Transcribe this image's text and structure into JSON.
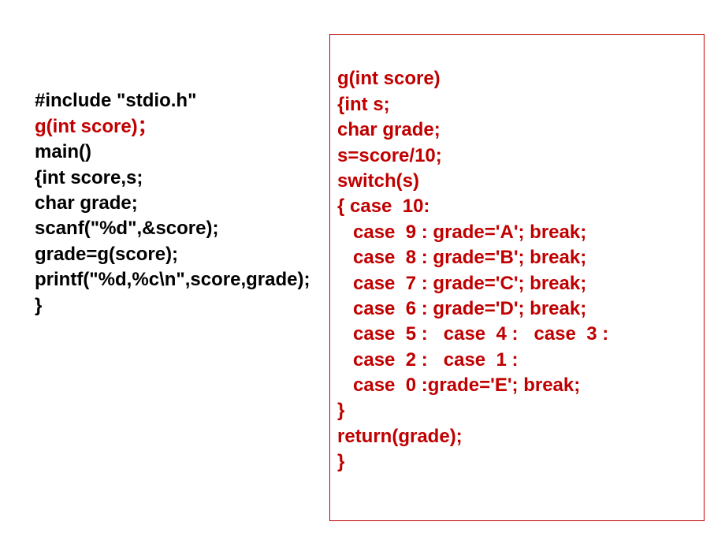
{
  "left": {
    "l1": "#include \"stdio.h\"",
    "l2": "g(int score)；",
    "l3": "main()",
    "l4": "{int score,s;",
    "l5": "char grade;",
    "l6": "scanf(\"%d\",&score);",
    "l7": "grade=g(score);",
    "l8": "printf(\"%d,%c\\n\",score,grade);",
    "l9": "}"
  },
  "right": {
    "l1": "g(int score)",
    "l2": "{int s;",
    "l3": "char grade;",
    "l4": "s=score/10;",
    "l5": "switch(s)",
    "l6": "{ case  10:",
    "l7": "   case  9 : grade='A'; break;",
    "l8": "   case  8 : grade='B'; break;",
    "l9": "   case  7 : grade='C'; break;",
    "l10": "   case  6 : grade='D'; break;",
    "l11": "   case  5 :   case  4 :   case  3 :",
    "l12": "   case  2 :   case  1 :",
    "l13": "   case  0 :grade='E'; break;",
    "l14": "}",
    "l15": "return(grade);",
    "l16": "}"
  }
}
